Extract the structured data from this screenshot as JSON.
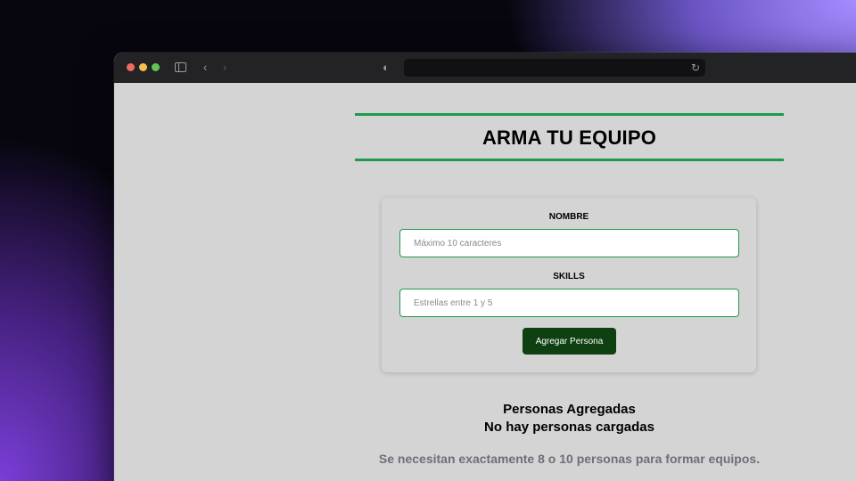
{
  "browser": {
    "icons": {
      "sidebar": "sidebar-icon",
      "back": "chevron-left-icon",
      "forward": "chevron-right-icon",
      "security": "shield-icon",
      "reload": "reload-icon"
    },
    "glyphs": {
      "back": "‹",
      "forward": "›",
      "shield": "◐",
      "reload": "↻"
    }
  },
  "page": {
    "title": "ARMA TU EQUIPO"
  },
  "form": {
    "nombre": {
      "label": "NOMBRE",
      "placeholder": "Máximo 10 caracteres",
      "value": ""
    },
    "skills": {
      "label": "SKILLS",
      "placeholder": "Estrellas entre 1 y 5",
      "value": ""
    },
    "submit_label": "Agregar Persona"
  },
  "people": {
    "heading": "Personas Agregadas",
    "empty_message": "No hay personas cargadas"
  },
  "requirement_message": "Se necesitan exactamente 8 o 10 personas para formar equipos.",
  "colors": {
    "accent_green": "#1f9a4a",
    "button_green": "#0e4012",
    "page_background": "#d4d4d4"
  }
}
